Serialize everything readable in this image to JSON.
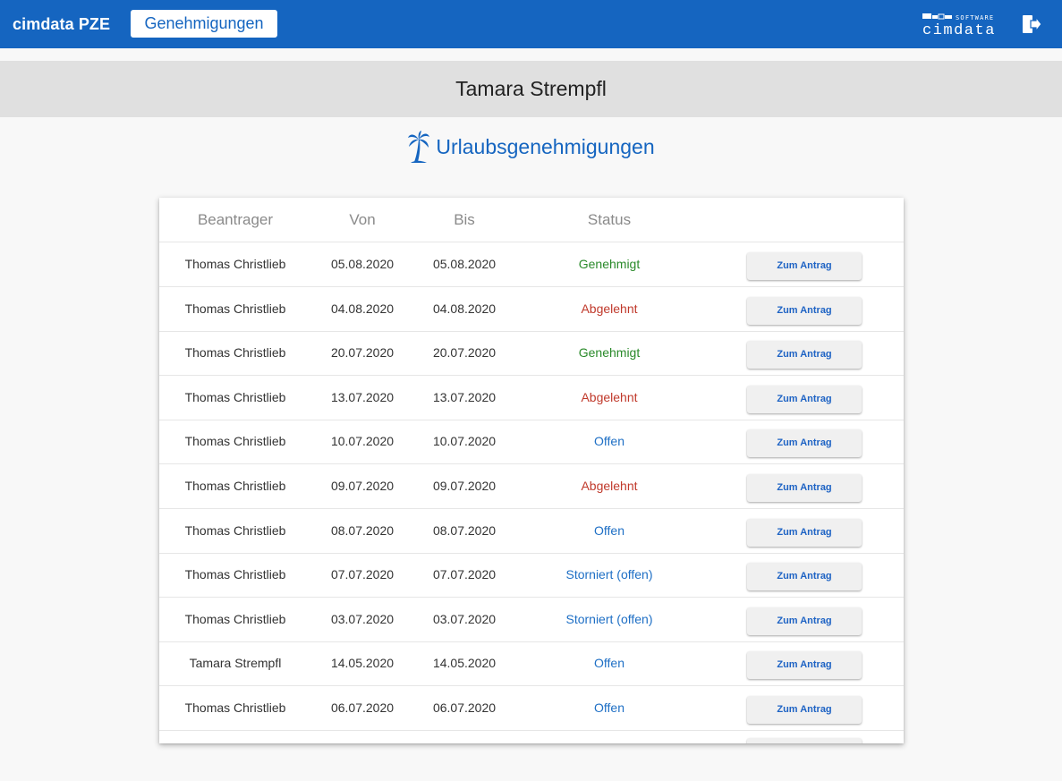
{
  "header": {
    "app_title": "cimdata PZE",
    "nav_button": "Genehmigungen",
    "logo_top": "SOFTWARE",
    "logo_main": "cimdata",
    "brand_color": "#1565c0"
  },
  "user": {
    "name": "Tamara Strempfl"
  },
  "section": {
    "title": "Urlaubsgenehmigungen",
    "icon": "palm-tree-icon"
  },
  "table": {
    "columns": [
      "Beantrager",
      "Von",
      "Bis",
      "Status",
      ""
    ],
    "button_label": "Zum Antrag",
    "rows": [
      {
        "name": "Thomas Christlieb",
        "von": "05.08.2020",
        "bis": "05.08.2020",
        "status": "Genehmigt",
        "kind": "ok"
      },
      {
        "name": "Thomas Christlieb",
        "von": "04.08.2020",
        "bis": "04.08.2020",
        "status": "Abgelehnt",
        "kind": "bad"
      },
      {
        "name": "Thomas Christlieb",
        "von": "20.07.2020",
        "bis": "20.07.2020",
        "status": "Genehmigt",
        "kind": "ok"
      },
      {
        "name": "Thomas Christlieb",
        "von": "13.07.2020",
        "bis": "13.07.2020",
        "status": "Abgelehnt",
        "kind": "bad"
      },
      {
        "name": "Thomas Christlieb",
        "von": "10.07.2020",
        "bis": "10.07.2020",
        "status": "Offen",
        "kind": "open"
      },
      {
        "name": "Thomas Christlieb",
        "von": "09.07.2020",
        "bis": "09.07.2020",
        "status": "Abgelehnt",
        "kind": "bad"
      },
      {
        "name": "Thomas Christlieb",
        "von": "08.07.2020",
        "bis": "08.07.2020",
        "status": "Offen",
        "kind": "open"
      },
      {
        "name": "Thomas Christlieb",
        "von": "07.07.2020",
        "bis": "07.07.2020",
        "status": "Storniert (offen)",
        "kind": "open"
      },
      {
        "name": "Thomas Christlieb",
        "von": "03.07.2020",
        "bis": "03.07.2020",
        "status": "Storniert (offen)",
        "kind": "open"
      },
      {
        "name": "Tamara Strempfl",
        "von": "14.05.2020",
        "bis": "14.05.2020",
        "status": "Offen",
        "kind": "open"
      },
      {
        "name": "Thomas Christlieb",
        "von": "06.07.2020",
        "bis": "06.07.2020",
        "status": "Offen",
        "kind": "open"
      }
    ]
  },
  "status_colors": {
    "ok": "#2a8a2a",
    "bad": "#c0392b",
    "open": "#1e6fc5"
  }
}
